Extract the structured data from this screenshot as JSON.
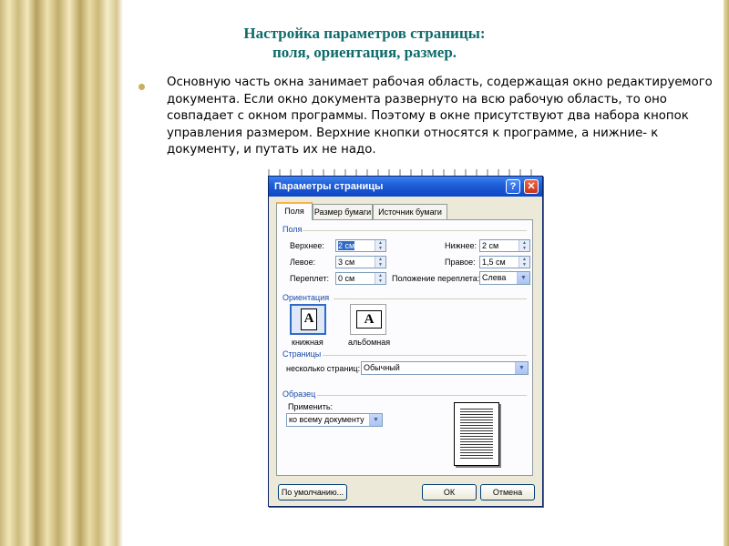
{
  "slide": {
    "title_line1": "Настройка параметров страницы:",
    "title_line2": "поля, ориентация, размер.",
    "body": "Основную часть окна занимает рабочая область, содержащая окно редактируемого документа. Если окно документа развернуто на всю рабочую область, то оно совпадает с окном программы. Поэтому в окне присутствуют два набора кнопок управления размером. Верхние кнопки относятся к программе, а нижние- к документу, и путать их не надо."
  },
  "dialog": {
    "title": "Параметры страницы",
    "help_label": "?",
    "close_label": "✕",
    "tabs": [
      "Поля",
      "Размер бумаги",
      "Источник бумаги"
    ],
    "margins": {
      "section": "Поля",
      "top_label": "Верхнее:",
      "top_value": "2 см",
      "bottom_label": "Нижнее:",
      "bottom_value": "2 см",
      "left_label": "Левое:",
      "left_value": "3 см",
      "right_label": "Правое:",
      "right_value": "1,5 см",
      "gutter_label": "Переплет:",
      "gutter_value": "0 см",
      "gutter_pos_label": "Положение переплета:",
      "gutter_pos_value": "Слева"
    },
    "orientation": {
      "section": "Ориентация",
      "portrait_label": "книжная",
      "landscape_label": "альбомная",
      "glyph": "A"
    },
    "pages": {
      "section": "Страницы",
      "multiple_label": "несколько страниц:",
      "multiple_value": "Обычный"
    },
    "preview": {
      "section": "Образец",
      "apply_label": "Применить:",
      "apply_value": "ко всему документу"
    },
    "buttons": {
      "default_label": "По умолчанию...",
      "ok_label": "ОК",
      "cancel_label": "Отмена"
    }
  }
}
